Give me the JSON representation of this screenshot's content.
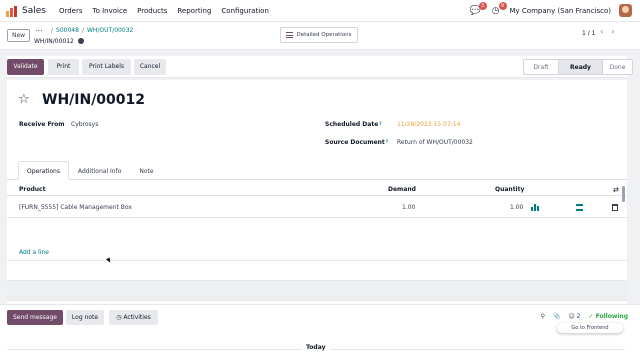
{
  "navbar": {
    "app_name": "Sales",
    "menu": [
      "Orders",
      "To Invoice",
      "Products",
      "Reporting",
      "Configuration"
    ],
    "messages_count": "3",
    "activities_count": "9",
    "company": "My Company (San Francisco)"
  },
  "control": {
    "new_label": "New",
    "breadcrumb_dots": "...",
    "breadcrumb": [
      "S00048",
      "WH/OUT/00032"
    ],
    "current": "WH/IN/00012",
    "detailed_operations": "Detailed Operations",
    "pager": "1 / 1"
  },
  "statusbar": {
    "buttons": {
      "validate": "Validate",
      "print": "Print",
      "print_labels": "Print Labels",
      "cancel": "Cancel"
    },
    "stages": [
      "Draft",
      "Ready",
      "Done"
    ],
    "active_stage": "Ready"
  },
  "record": {
    "title": "WH/IN/00012",
    "receive_from_label": "Receive From",
    "receive_from": "Cybrosys",
    "scheduled_date_label": "Scheduled Date",
    "scheduled_date": "11/28/2023 15:07:14",
    "source_document_label": "Source Document",
    "source_document": "Return of WH/OUT/00032",
    "help_mark": "?"
  },
  "tabs": [
    "Operations",
    "Additional Info",
    "Note"
  ],
  "table": {
    "columns": {
      "product": "Product",
      "demand": "Demand",
      "quantity": "Quantity"
    },
    "rows": [
      {
        "product": "[FURN_5555] Cable Management Box",
        "demand": "1.00",
        "quantity": "1.00"
      }
    ],
    "add_line": "Add a line"
  },
  "chatter": {
    "send_message": "Send message",
    "log_note": "Log note",
    "activities": "Activities",
    "followers_count": "2",
    "following": "Following",
    "tooltip": "Go to Frontend",
    "today": "Today"
  },
  "colors": {
    "primary": "#714b67",
    "link": "#017e84",
    "following": "#28a745",
    "date": "#e6a23c"
  }
}
